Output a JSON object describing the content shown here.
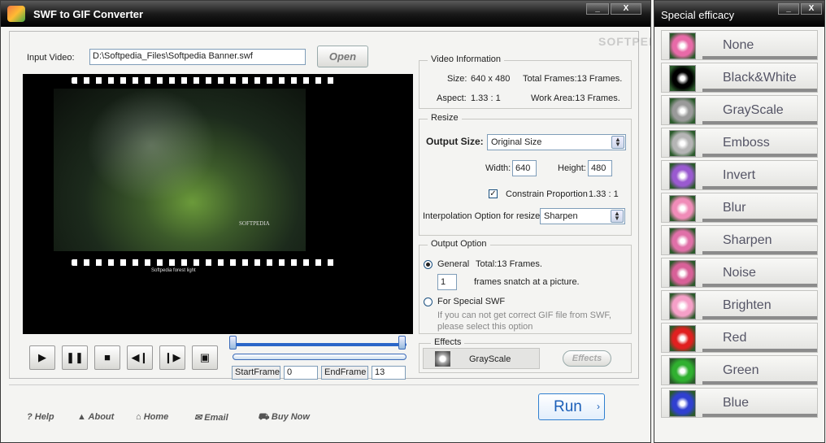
{
  "main": {
    "title": "SWF to GIF Converter",
    "win_minimize": "_",
    "win_close": "X",
    "input_label": "Input Video:",
    "input_value": "D:\\Softpedia_Files\\Softpedia Banner.swf",
    "open_label": "Open",
    "preview_caption": "Softpedia forest light",
    "preview_logo": "SOFTPEDIA",
    "video_info": {
      "legend": "Video Information",
      "size_label": "Size:",
      "size_value": "640 x 480",
      "total_frames": "Total Frames:13 Frames.",
      "aspect_label": "Aspect:",
      "aspect_value": "1.33 : 1",
      "work_area": "Work Area:13 Frames."
    },
    "resize": {
      "legend": "Resize",
      "output_size_label": "Output Size:",
      "output_size_value": "Original Size",
      "width_label": "Width:",
      "width_value": "640",
      "height_label": "Height:",
      "height_value": "480",
      "constrain_label": "Constrain Proportion",
      "constrain_value": "1.33 : 1",
      "interp_label": "Interpolation Option for resize:",
      "interp_value": "Sharpen"
    },
    "output": {
      "legend": "Output Option",
      "general_label": "General",
      "general_total": "Total:13 Frames.",
      "snatch_value": "1",
      "snatch_label": "frames snatch at a picture.",
      "special_label": "For Special SWF",
      "special_hint_1": "If you can not get correct GIF file from SWF,",
      "special_hint_2": "please select this option"
    },
    "effects": {
      "legend": "Effects",
      "current": "GrayScale",
      "button": "Effects"
    },
    "frames": {
      "start_label": "StartFrame",
      "start_value": "0",
      "end_label": "EndFrame",
      "end_value": "13"
    },
    "footer": {
      "help": "Help",
      "about": "About",
      "home": "Home",
      "email": "Email",
      "buy": "Buy Now",
      "run": "Run"
    },
    "watermark": "SOFTPEDIA"
  },
  "effects_panel": {
    "title": "Special efficacy",
    "win_minimize": "_",
    "win_close": "X",
    "items": [
      {
        "name": "None",
        "color": "#e86aa8"
      },
      {
        "name": "Black&White",
        "color": "#000000"
      },
      {
        "name": "GrayScale",
        "color": "#9a9a9a"
      },
      {
        "name": "Emboss",
        "color": "#b5b5b5"
      },
      {
        "name": "Invert",
        "color": "#9a5ad0"
      },
      {
        "name": "Blur",
        "color": "#f08cb8"
      },
      {
        "name": "Sharpen",
        "color": "#e070a8"
      },
      {
        "name": "Noise",
        "color": "#d86098"
      },
      {
        "name": "Brighten",
        "color": "#f6a0c8"
      },
      {
        "name": "Red",
        "color": "#e02020"
      },
      {
        "name": "Green",
        "color": "#30b030"
      },
      {
        "name": "Blue",
        "color": "#3040d0"
      }
    ]
  }
}
